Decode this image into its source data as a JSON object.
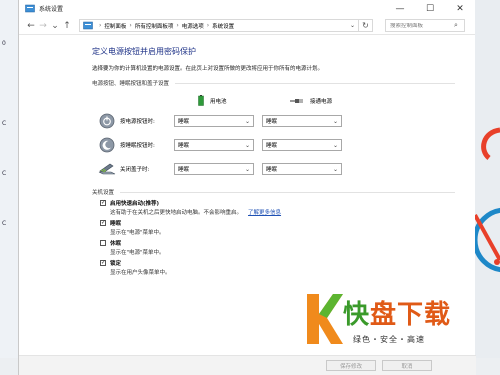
{
  "window": {
    "title": "系统设置",
    "controls": [
      "—",
      "☐",
      "✕"
    ]
  },
  "address": {
    "breadcrumbs": [
      "控制面板",
      "所有控制面板项",
      "电源选项",
      "系统设置"
    ],
    "search_placeholder": "搜索控制面板"
  },
  "main": {
    "heading": "定义电源按钮并启用密码保护",
    "description": "选择要为你的计算机设置的电源设置。在此页上对设置所做的更改将应用于你所有的电源计划。",
    "group_buttons": "电源按钮、睡眠按钮和盖子设置",
    "col_battery": "用电池",
    "col_plugged": "接通电源",
    "rows": [
      {
        "label": "按电源按钮时:",
        "battery": "睡眠",
        "plugged": "睡眠"
      },
      {
        "label": "按睡眠按钮时:",
        "battery": "睡眠",
        "plugged": "睡眠"
      },
      {
        "label": "关闭盖子时:",
        "battery": "睡眠",
        "plugged": "睡眠"
      }
    ],
    "group_shutdown": "关机设置",
    "options": [
      {
        "label": "启用快速启动(推荐)",
        "desc": "这有助于在关机之后更快地启动电脑。不会影响重启。",
        "link": "了解更多信息",
        "checked": true
      },
      {
        "label": "睡眠",
        "desc": "显示在\"电源\"菜单中。",
        "checked": true
      },
      {
        "label": "休眠",
        "desc": "显示在\"电源\"菜单中。",
        "checked": false
      },
      {
        "label": "锁定",
        "desc": "显示在用户头像菜单中。",
        "checked": true
      }
    ]
  },
  "footer": {
    "save": "保存修改",
    "cancel": "取消"
  },
  "watermark": {
    "brand_a": "快",
    "brand_b": "盘下载",
    "tagline": "绿色・安全・高速"
  },
  "desktop_left": [
    "0",
    "C",
    "C",
    "C"
  ]
}
